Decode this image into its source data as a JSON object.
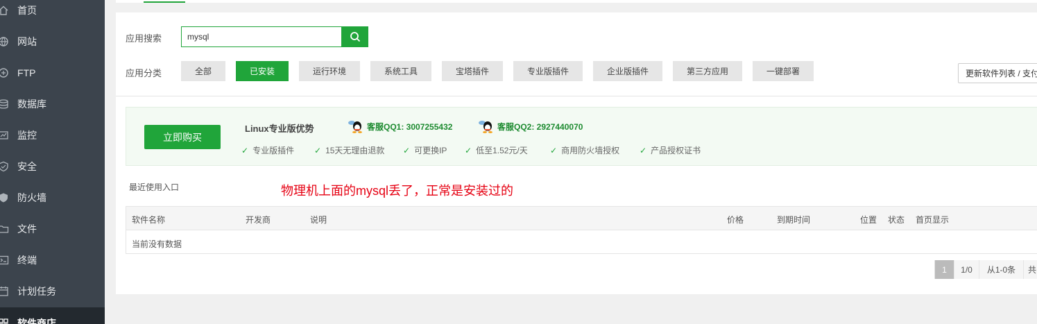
{
  "sidebar": {
    "items": [
      {
        "label": "首页",
        "icon": "home-icon"
      },
      {
        "label": "网站",
        "icon": "globe-icon"
      },
      {
        "label": "FTP",
        "icon": "ftp-icon"
      },
      {
        "label": "数据库",
        "icon": "database-icon"
      },
      {
        "label": "监控",
        "icon": "monitor-icon"
      },
      {
        "label": "安全",
        "icon": "shield-icon"
      },
      {
        "label": "防火墙",
        "icon": "firewall-icon"
      },
      {
        "label": "文件",
        "icon": "folder-icon"
      },
      {
        "label": "终端",
        "icon": "terminal-icon"
      },
      {
        "label": "计划任务",
        "icon": "tasks-icon"
      },
      {
        "label": "软件商店",
        "icon": "store-icon",
        "active": true
      }
    ]
  },
  "search": {
    "label": "应用搜索",
    "value": "mysql"
  },
  "category": {
    "label": "应用分类",
    "items": [
      "全部",
      "已安装",
      "运行环境",
      "系统工具",
      "宝塔插件",
      "专业版插件",
      "企业版插件",
      "第三方应用",
      "一键部署"
    ],
    "active_index": 1
  },
  "refresh_label": "更新软件列表 / 支付",
  "promo": {
    "buy_label": "立即购买",
    "title": "Linux专业版优势",
    "qq1": "客服QQ1: 3007255432",
    "qq2": "客服QQ2: 2927440070",
    "features": [
      "专业版插件",
      "15天无理由退款",
      "可更换IP",
      "低至1.52元/天",
      "商用防火墙授权",
      "产品授权证书"
    ]
  },
  "recent_label": "最近使用入口",
  "annotation": "物理机上面的mysql丢了，正常是安装过的",
  "table": {
    "headers": [
      "软件名称",
      "开发商",
      "说明",
      "价格",
      "到期时间",
      "位置",
      "状态",
      "首页显示"
    ],
    "empty_text": "当前没有数据"
  },
  "pagination": {
    "current": "1",
    "pages": "1/0",
    "range": "从1-0条",
    "total_prefix": "共"
  },
  "colors": {
    "accent": "#20a53a",
    "sidebar": "#3c444d",
    "annotation": "#e60012"
  }
}
